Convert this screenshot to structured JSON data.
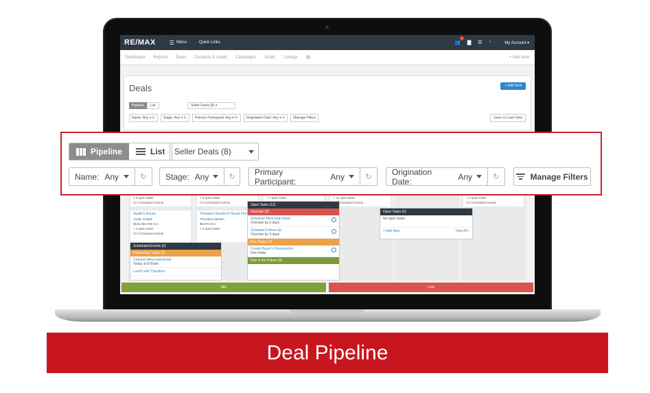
{
  "app": {
    "logo": "RE/MAX",
    "menu_label": "Menu",
    "quick_links_label": "Quick Links",
    "notification_count": "2",
    "account_label": "My Account"
  },
  "nav": {
    "items": [
      "Dashboard",
      "Reports",
      "Deals",
      "Contacts & Leads",
      "Campaigns",
      "Goals",
      "Listings"
    ],
    "add_new": "+ Add New"
  },
  "deals_page": {
    "title": "Deals",
    "add_deal_label": "+ Add Deal",
    "view_pipeline": "Pipeline",
    "view_list": "List",
    "deal_type_selected": "Seller Deals (8)",
    "filters": [
      {
        "label": "Name:",
        "value": "Any"
      },
      {
        "label": "Stage:",
        "value": "Any"
      },
      {
        "label": "Primary Participant:",
        "value": "Any"
      },
      {
        "label": "Origination Date:",
        "value": "Any"
      }
    ],
    "manage_filters_label": "Manage Filters",
    "save_load_view_label": "Save or Load View"
  },
  "board": {
    "card_stats": [
      {
        "tasks": "8 open tasks",
        "events": "3 scheduled events"
      },
      {
        "tasks": "9 open tasks",
        "events": "5 scheduled events"
      },
      {
        "tasks": "1 open tasks",
        "events": "1 scheduled events"
      },
      {
        "tasks": "12 open tasks",
        "events": "5 scheduled events"
      },
      {
        "tasks": "0 open tasks",
        "events": "0 scheduled events"
      }
    ],
    "card_austin": {
      "title": "Austin's House",
      "person": "Austin Joseph",
      "amount": "$123,456,789 GCI",
      "tasks": "2 open tasks",
      "events": "5 scheduled events"
    },
    "card_theodore": {
      "title": "Theodore Newton's House Hunt",
      "person": "Theodore Newton",
      "amount": "$6,876 GCI",
      "tasks": "0 open tasks"
    },
    "open_tasks_popup": {
      "header": "Open Tasks (12)",
      "overdue_label": "Overdue (2)",
      "tasks": [
        {
          "name": "Schedule Meet-and-Greet",
          "due": "Overdue by 5 days"
        },
        {
          "name": "Schedule Follow-Up",
          "due": "Overdue by 3 days"
        }
      ],
      "due_today_label": "Due Today (1)",
      "today_task": {
        "name": "Create Buyer's Presentation",
        "due": "Due today"
      },
      "future_label": "Due in the Future (9)"
    },
    "events_popup": {
      "header": "Scheduled Events (5)",
      "happening_label": "Happening Today (2)",
      "events": [
        {
          "name": "Conduct Meet-and-Greet",
          "time": "Today at 9:00am"
        },
        {
          "name": "Lunch with Theodore",
          "time": ""
        }
      ]
    },
    "empty_popup": {
      "header": "Open Tasks (0)",
      "empty_text": "No open tasks",
      "add_new": "+ Add New",
      "view_all": "View All ›"
    },
    "win_label": "Win",
    "lost_label": "Lost"
  },
  "banner": {
    "text": "Deal Pipeline"
  },
  "colors": {
    "brand_red": "#c8161e",
    "topbar": "#2f3944",
    "accent_blue": "#2f86c9",
    "win_green": "#7ea33a",
    "lost_red": "#d9534f"
  }
}
